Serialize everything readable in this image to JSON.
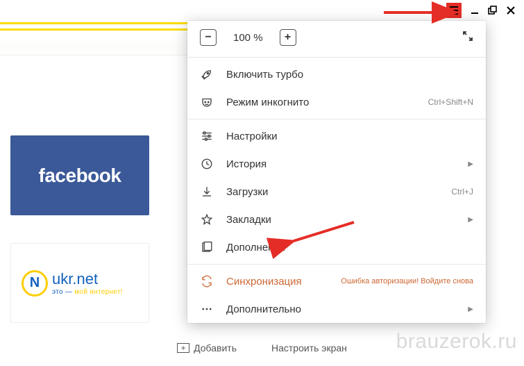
{
  "window": {
    "menu_tooltip": "Меню"
  },
  "menu": {
    "zoom": {
      "level": "100 %"
    },
    "turbo": "Включить турбо",
    "incognito": {
      "label": "Режим инкогнито",
      "shortcut": "Ctrl+Shift+N"
    },
    "settings": "Настройки",
    "history": "История",
    "downloads": {
      "label": "Загрузки",
      "shortcut": "Ctrl+J"
    },
    "bookmarks": "Закладки",
    "addons": "Дополнения",
    "sync": {
      "label": "Синхронизация",
      "error": "Ошибка авторизации! Войдите снова"
    },
    "more": "Дополнительно"
  },
  "tiles": {
    "facebook": "facebook",
    "ukrnet": {
      "brand": "ukr",
      "tld": ".net",
      "tagline_a": "это — ",
      "tagline_b": "мой интернет!",
      "glyph": "N"
    }
  },
  "footer": {
    "add": "Добавить",
    "configure": "Настроить экран"
  },
  "watermark": "brauzerok.ru"
}
